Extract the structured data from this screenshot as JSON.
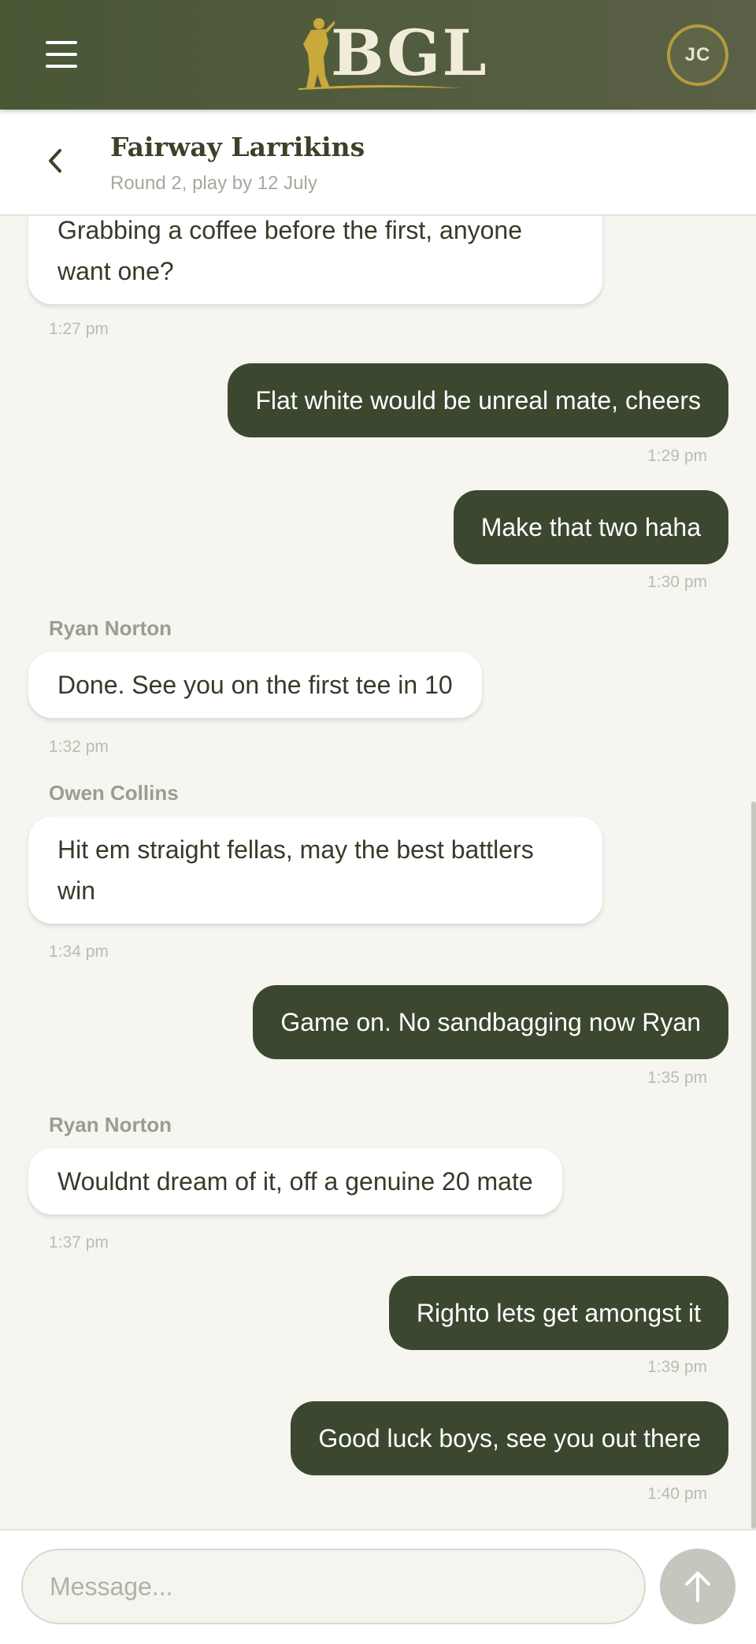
{
  "app": {
    "logo_text": "BGL",
    "user_initials": "JC"
  },
  "conversation": {
    "title": "Fairway Larrikins",
    "subtitle": "Round 2, play by 12 July"
  },
  "messages": [
    {
      "direction": "in",
      "sender": "",
      "text": "Grabbing a coffee before the first, anyone want one?",
      "time": "1:27 pm"
    },
    {
      "direction": "out",
      "text": "Flat white would be unreal mate, cheers",
      "time": "1:29 pm"
    },
    {
      "direction": "out",
      "text": "Make that two haha",
      "time": "1:30 pm"
    },
    {
      "direction": "in",
      "sender": "Ryan Norton",
      "text": "Done. See you on the first tee in 10",
      "time": "1:32 pm"
    },
    {
      "direction": "in",
      "sender": "Owen Collins",
      "text": "Hit em straight fellas, may the best battlers win",
      "time": "1:34 pm"
    },
    {
      "direction": "out",
      "text": "Game on. No sandbagging now Ryan",
      "time": "1:35 pm"
    },
    {
      "direction": "in",
      "sender": "Ryan Norton",
      "text": "Wouldnt dream of it, off a genuine 20 mate",
      "time": "1:37 pm"
    },
    {
      "direction": "out",
      "text": "Righto lets get amongst it",
      "time": "1:39 pm"
    },
    {
      "direction": "out",
      "text": "Good luck boys, see you out there",
      "time": "1:40 pm"
    }
  ],
  "composer": {
    "placeholder": "Message..."
  },
  "colors": {
    "header_bg": "#4f5a3a",
    "accent_gold": "#b59b3e",
    "outgoing_bubble": "#3c4730",
    "incoming_bubble": "#ffffff",
    "page_bg": "#f6f5f0"
  },
  "icons": {
    "menu": "hamburger-menu-icon",
    "back": "chevron-left-icon",
    "send": "arrow-up-icon",
    "logo_figure": "golfer-silhouette-icon"
  }
}
